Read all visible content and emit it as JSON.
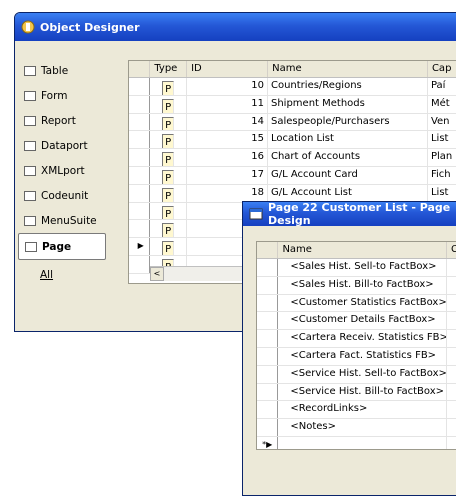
{
  "object_designer": {
    "title": "Object Designer",
    "nav": [
      {
        "label": "Table",
        "icon": "table-icon"
      },
      {
        "label": "Form",
        "icon": "form-icon"
      },
      {
        "label": "Report",
        "icon": "report-icon"
      },
      {
        "label": "Dataport",
        "icon": "dataport-icon"
      },
      {
        "label": "XMLport",
        "icon": "xmlport-icon"
      },
      {
        "label": "Codeunit",
        "icon": "codeunit-icon"
      },
      {
        "label": "MenuSuite",
        "icon": "menusuite-icon"
      },
      {
        "label": "Page",
        "icon": "page-icon"
      },
      {
        "label": "All",
        "icon": ""
      }
    ],
    "columns": {
      "type": "Type",
      "id": "ID",
      "name": "Name",
      "caption": "Cap"
    },
    "rows": [
      {
        "id": "10",
        "name": "Countries/Regions",
        "caption": "Paí"
      },
      {
        "id": "11",
        "name": "Shipment Methods",
        "caption": "Mét"
      },
      {
        "id": "14",
        "name": "Salespeople/Purchasers",
        "caption": "Ven"
      },
      {
        "id": "15",
        "name": "Location List",
        "caption": "List"
      },
      {
        "id": "16",
        "name": "Chart of Accounts",
        "caption": "Plan"
      },
      {
        "id": "17",
        "name": "G/L Account Card",
        "caption": "Fich"
      },
      {
        "id": "18",
        "name": "G/L Account List",
        "caption": "List"
      },
      {
        "id": "",
        "name": "",
        "caption": ""
      },
      {
        "id": "",
        "name": "",
        "caption": ""
      },
      {
        "id": "",
        "name": "",
        "caption": ""
      },
      {
        "id": "",
        "name": "",
        "caption": ""
      }
    ],
    "current_row_marker": "▶",
    "scroll_left": "<"
  },
  "page_designer": {
    "title": "Page 22 Customer List - Page Design",
    "columns": {
      "name": "Name",
      "c2": "C"
    },
    "rows": [
      "<Sales Hist. Sell-to FactBox>",
      "<Sales Hist. Bill-to FactBox>",
      "<Customer Statistics FactBox>",
      "<Customer Details FactBox>",
      "<Cartera Receiv. Statistics FB>",
      "<Cartera Fact. Statistics FB>",
      "<Service Hist. Sell-to FactBox>",
      "<Service Hist. Bill-to FactBox>",
      "<RecordLinks>",
      "<Notes>"
    ],
    "new_row_marker": "*▶"
  }
}
